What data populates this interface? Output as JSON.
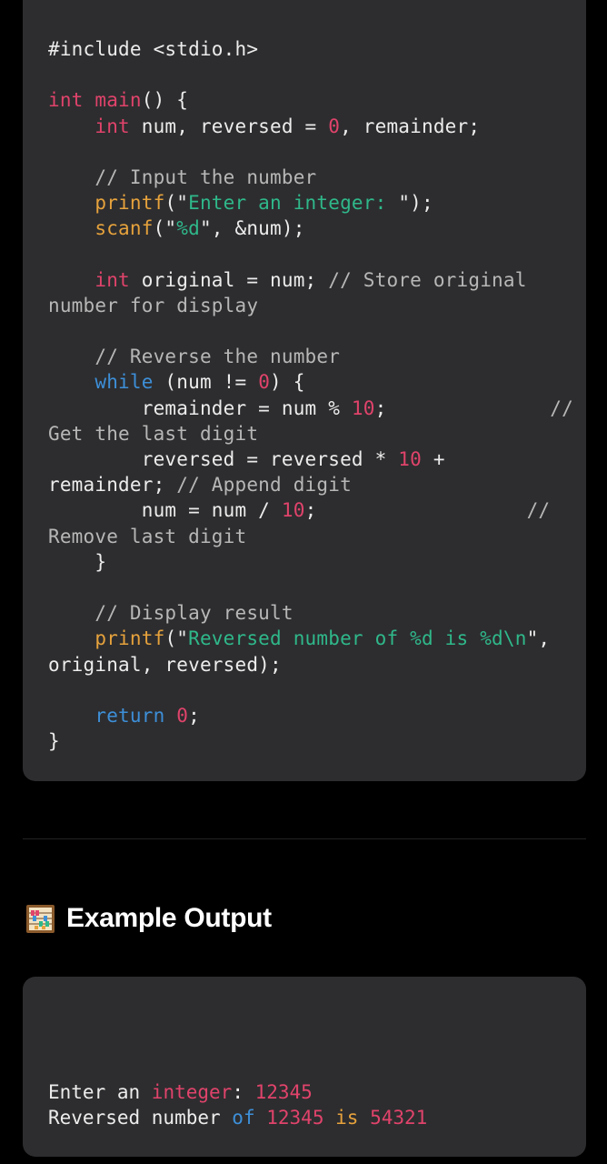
{
  "code": {
    "lines": [
      [
        {
          "t": "#include ",
          "c": "plain"
        },
        {
          "t": "<stdio.h>",
          "c": "plain"
        }
      ],
      [],
      [
        {
          "t": "int ",
          "c": "kw-int"
        },
        {
          "t": "main",
          "c": "kw-int"
        },
        {
          "t": "() {",
          "c": "plain"
        }
      ],
      [
        {
          "t": "    ",
          "c": "plain"
        },
        {
          "t": "int",
          "c": "kw-int"
        },
        {
          "t": " num, reversed = ",
          "c": "plain"
        },
        {
          "t": "0",
          "c": "num"
        },
        {
          "t": ", remainder;",
          "c": "plain"
        }
      ],
      [],
      [
        {
          "t": "    // Input the number",
          "c": "cmt"
        }
      ],
      [
        {
          "t": "    ",
          "c": "plain"
        },
        {
          "t": "printf",
          "c": "fn"
        },
        {
          "t": "(\"",
          "c": "plain"
        },
        {
          "t": "Enter an integer: ",
          "c": "str"
        },
        {
          "t": "\");",
          "c": "plain"
        }
      ],
      [
        {
          "t": "    ",
          "c": "plain"
        },
        {
          "t": "scanf",
          "c": "fn"
        },
        {
          "t": "(\"",
          "c": "plain"
        },
        {
          "t": "%d",
          "c": "str"
        },
        {
          "t": "\", &num);",
          "c": "plain"
        }
      ],
      [],
      [
        {
          "t": "    ",
          "c": "plain"
        },
        {
          "t": "int",
          "c": "kw-int"
        },
        {
          "t": " original = num; ",
          "c": "plain"
        },
        {
          "t": "// Store original",
          "c": "cmt"
        }
      ],
      [
        {
          "t": "number for display",
          "c": "cmt"
        }
      ],
      [],
      [
        {
          "t": "    // Reverse the number",
          "c": "cmt"
        }
      ],
      [
        {
          "t": "    ",
          "c": "plain"
        },
        {
          "t": "while",
          "c": "kw-blue"
        },
        {
          "t": " (num != ",
          "c": "plain"
        },
        {
          "t": "0",
          "c": "num"
        },
        {
          "t": ") {",
          "c": "plain"
        }
      ],
      [
        {
          "t": "        remainder = num % ",
          "c": "plain"
        },
        {
          "t": "10",
          "c": "num"
        },
        {
          "t": ";",
          "c": "plain"
        },
        {
          "t": "              //",
          "c": "cmt"
        }
      ],
      [
        {
          "t": "Get the last digit",
          "c": "cmt"
        }
      ],
      [
        {
          "t": "        reversed = reversed * ",
          "c": "plain"
        },
        {
          "t": "10",
          "c": "num"
        },
        {
          "t": " +",
          "c": "plain"
        }
      ],
      [
        {
          "t": "remainder; ",
          "c": "plain"
        },
        {
          "t": "// Append digit",
          "c": "cmt"
        }
      ],
      [
        {
          "t": "        num = num / ",
          "c": "plain"
        },
        {
          "t": "10",
          "c": "num"
        },
        {
          "t": ";",
          "c": "plain"
        },
        {
          "t": "                  //",
          "c": "cmt"
        }
      ],
      [
        {
          "t": "Remove last digit",
          "c": "cmt"
        }
      ],
      [
        {
          "t": "    }",
          "c": "plain"
        }
      ],
      [],
      [
        {
          "t": "    // Display result",
          "c": "cmt"
        }
      ],
      [
        {
          "t": "    ",
          "c": "plain"
        },
        {
          "t": "printf",
          "c": "fn"
        },
        {
          "t": "(\"",
          "c": "plain"
        },
        {
          "t": "Reversed number of %d is %d\\n",
          "c": "str"
        },
        {
          "t": "\",",
          "c": "plain"
        }
      ],
      [
        {
          "t": "original, reversed);",
          "c": "plain"
        }
      ],
      [],
      [
        {
          "t": "    ",
          "c": "plain"
        },
        {
          "t": "return",
          "c": "kw-blue"
        },
        {
          "t": " ",
          "c": "plain"
        },
        {
          "t": "0",
          "c": "num"
        },
        {
          "t": ";",
          "c": "plain"
        }
      ],
      [
        {
          "t": "}",
          "c": "plain"
        }
      ]
    ]
  },
  "section": {
    "icon": "abacus-icon",
    "title": "Example Output"
  },
  "output": {
    "lines": [
      [
        {
          "t": "Enter an ",
          "c": "plain"
        },
        {
          "t": "integer",
          "c": "kw-int"
        },
        {
          "t": ": ",
          "c": "plain"
        },
        {
          "t": "12345",
          "c": "num"
        }
      ],
      [
        {
          "t": "Reversed number ",
          "c": "plain"
        },
        {
          "t": "of",
          "c": "kw-blue"
        },
        {
          "t": " ",
          "c": "plain"
        },
        {
          "t": "12345",
          "c": "num"
        },
        {
          "t": " ",
          "c": "plain"
        },
        {
          "t": "is",
          "c": "fn"
        },
        {
          "t": " ",
          "c": "plain"
        },
        {
          "t": "54321",
          "c": "num"
        }
      ]
    ]
  },
  "colors": {
    "background": "#000000",
    "card": "#2d2d2f",
    "keyword": "#e0436b",
    "keyword_blue": "#3d8fd8",
    "function": "#e6a23c",
    "string": "#2fb88a",
    "comment": "#b7b7b7"
  }
}
